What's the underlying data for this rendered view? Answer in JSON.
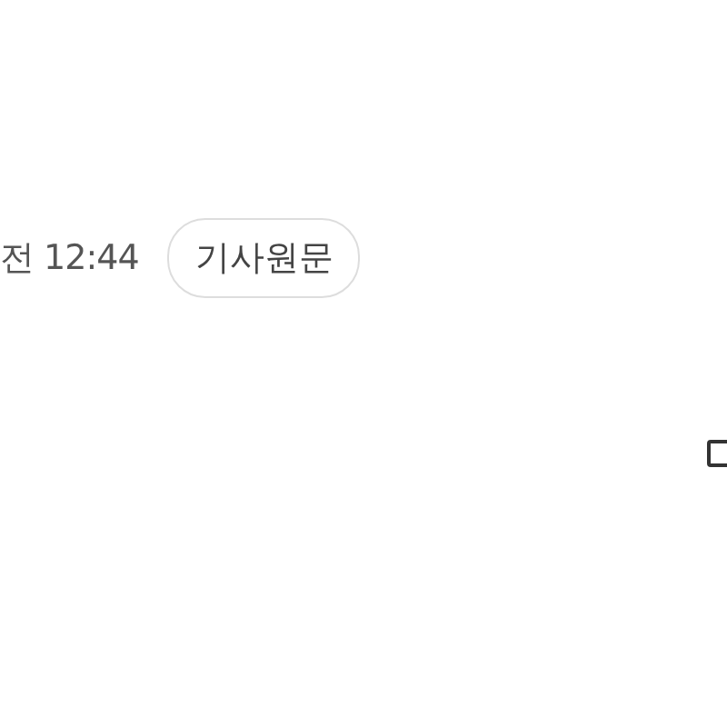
{
  "article_meta": {
    "time": "전 12:44",
    "original_link": "기사원문"
  }
}
